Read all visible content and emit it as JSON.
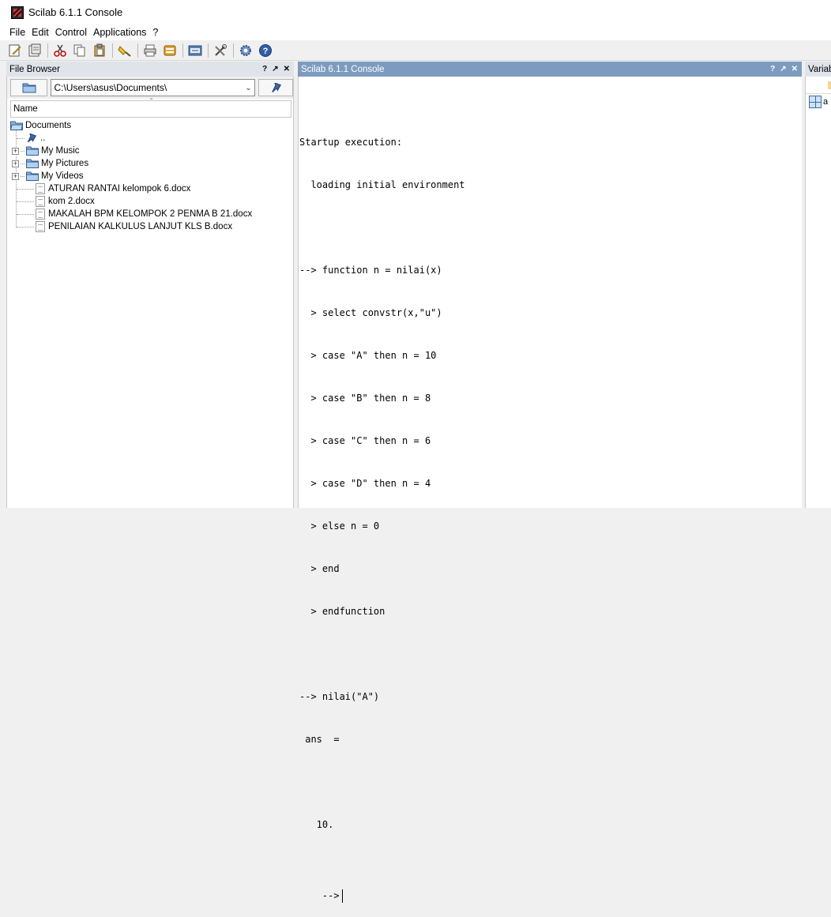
{
  "window": {
    "title": "Scilab 6.1.1 Console"
  },
  "menu": [
    "File",
    "Edit",
    "Control",
    "Applications",
    "?"
  ],
  "toolbar": {
    "icons": [
      "new-script-icon",
      "open-file-icon",
      "cut-icon",
      "copy-icon",
      "paste-icon",
      "clear-console-icon",
      "print-icon",
      "page-setup-icon",
      "scinotes-icon",
      "module-manager-icon",
      "preferences-icon",
      "help-icon"
    ]
  },
  "file_browser": {
    "title": "File Browser",
    "controls": [
      "?",
      "↗",
      "✕"
    ],
    "path": "C:\\Users\\asus\\Documents\\",
    "column_name": "Name",
    "root": "Documents",
    "parent": "..",
    "folders": [
      "My Music",
      "My Pictures",
      "My Videos"
    ],
    "files": [
      "ATURAN RANTAI kelompok 6.docx",
      "kom 2.docx",
      "MAKALAH BPM KELOMPOK 2 PENMA B 21.docx",
      "PENILAIAN KALKULUS LANJUT KLS B.docx"
    ]
  },
  "console": {
    "title": "Scilab 6.1.1 Console",
    "controls": [
      "?",
      "↗",
      "✕"
    ],
    "lines": [
      "Startup execution:",
      "  loading initial environment",
      "",
      "--> function n = nilai(x)",
      "  > select convstr(x,\"u\")",
      "  > case \"A\" then n = 10",
      "  > case \"B\" then n = 8",
      "  > case \"C\" then n = 6",
      "  > case \"D\" then n = 4",
      "  > else n = 0",
      "  > end",
      "  > endfunction",
      "",
      "--> nilai(\"A\")",
      " ans  =",
      "",
      "   10.",
      ""
    ],
    "prompt": "-->"
  },
  "variable_browser": {
    "title": "Variab",
    "item": "a"
  },
  "colors": {
    "active_header": "#7d9bbf",
    "inactive_header": "#dfe4ea",
    "tree_line": "#999999"
  }
}
